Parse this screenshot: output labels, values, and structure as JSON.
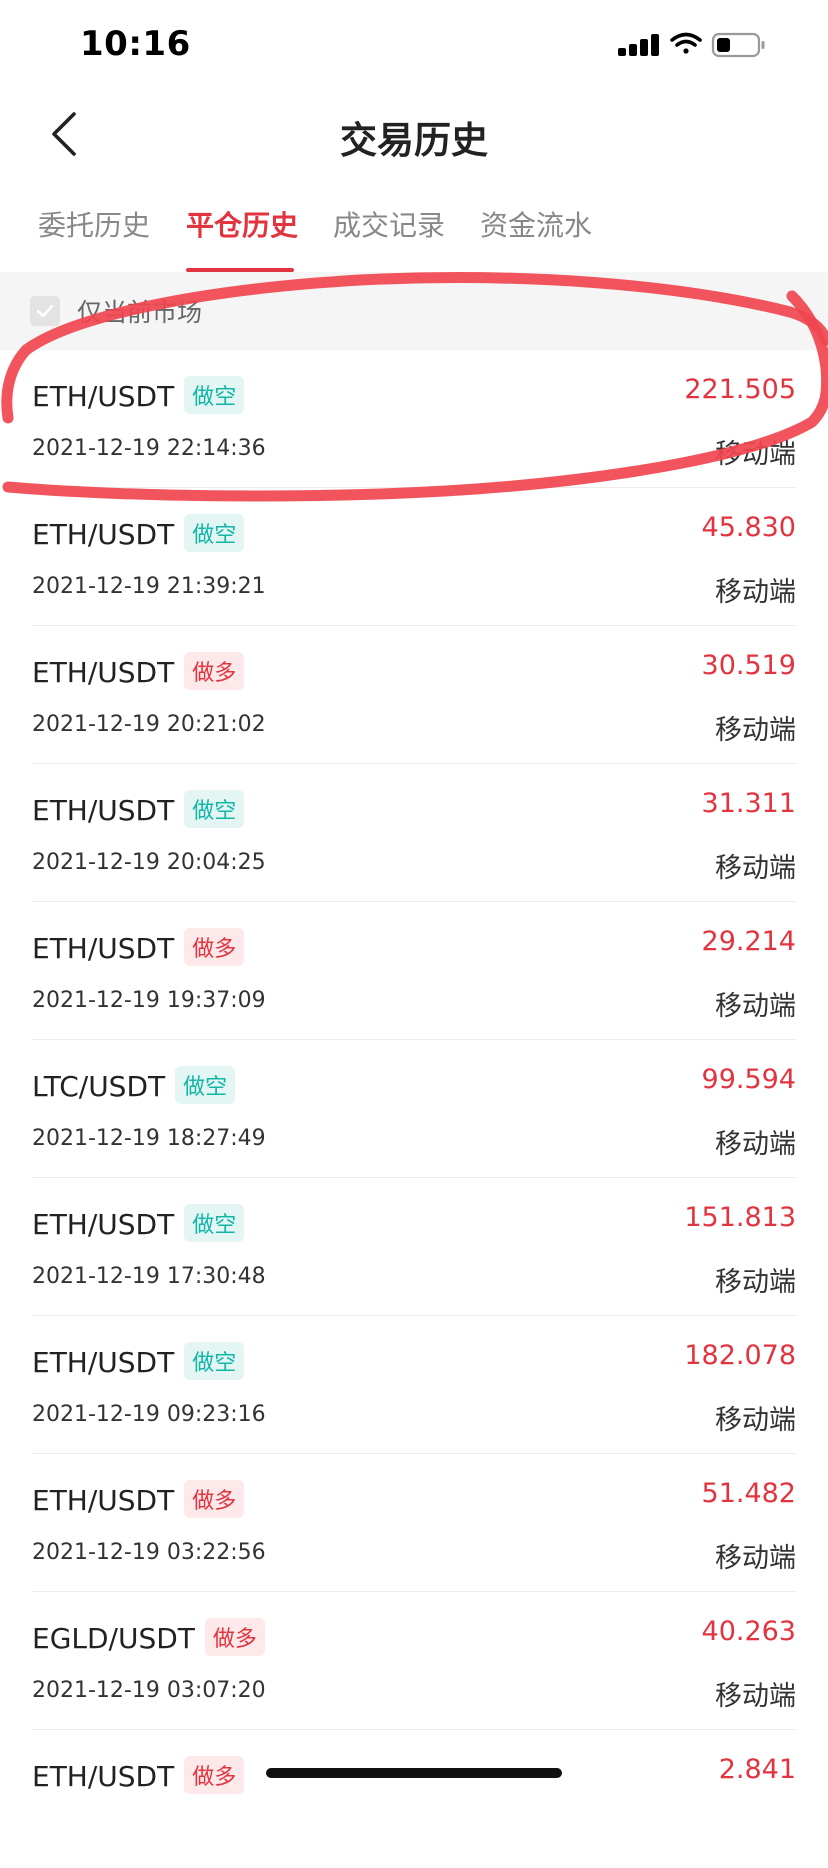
{
  "status_bar": {
    "time": "10:16"
  },
  "nav": {
    "title": "交易历史"
  },
  "tabs": [
    {
      "label": "委托历史",
      "active": false
    },
    {
      "label": "平仓历史",
      "active": true
    },
    {
      "label": "成交记录",
      "active": false
    },
    {
      "label": "资金流水",
      "active": false
    }
  ],
  "filter": {
    "label": "仅当前市场",
    "checked": true
  },
  "trades": [
    {
      "pair": "ETH/USDT",
      "side": "做空",
      "side_type": "short",
      "time": "2021-12-19 22:14:36",
      "amount": "221.505",
      "channel": "移动端"
    },
    {
      "pair": "ETH/USDT",
      "side": "做空",
      "side_type": "short",
      "time": "2021-12-19 21:39:21",
      "amount": "45.830",
      "channel": "移动端"
    },
    {
      "pair": "ETH/USDT",
      "side": "做多",
      "side_type": "long",
      "time": "2021-12-19 20:21:02",
      "amount": "30.519",
      "channel": "移动端"
    },
    {
      "pair": "ETH/USDT",
      "side": "做空",
      "side_type": "short",
      "time": "2021-12-19 20:04:25",
      "amount": "31.311",
      "channel": "移动端"
    },
    {
      "pair": "ETH/USDT",
      "side": "做多",
      "side_type": "long",
      "time": "2021-12-19 19:37:09",
      "amount": "29.214",
      "channel": "移动端"
    },
    {
      "pair": "LTC/USDT",
      "side": "做空",
      "side_type": "short",
      "time": "2021-12-19 18:27:49",
      "amount": "99.594",
      "channel": "移动端"
    },
    {
      "pair": "ETH/USDT",
      "side": "做空",
      "side_type": "short",
      "time": "2021-12-19 17:30:48",
      "amount": "151.813",
      "channel": "移动端"
    },
    {
      "pair": "ETH/USDT",
      "side": "做空",
      "side_type": "short",
      "time": "2021-12-19 09:23:16",
      "amount": "182.078",
      "channel": "移动端"
    },
    {
      "pair": "ETH/USDT",
      "side": "做多",
      "side_type": "long",
      "time": "2021-12-19 03:22:56",
      "amount": "51.482",
      "channel": "移动端"
    },
    {
      "pair": "EGLD/USDT",
      "side": "做多",
      "side_type": "long",
      "time": "2021-12-19 03:07:20",
      "amount": "40.263",
      "channel": "移动端"
    },
    {
      "pair": "ETH/USDT",
      "side": "做多",
      "side_type": "long",
      "time": "",
      "amount": "2.841",
      "channel": ""
    }
  ],
  "colors": {
    "accent": "#e2343f",
    "short": "#13b5a6",
    "long": "#e2343f",
    "annotation": "#f0454f"
  },
  "icons": {
    "back": "chevron-left-icon",
    "check": "check-icon",
    "signal": "cellular-signal-icon",
    "wifi": "wifi-icon",
    "battery": "battery-icon"
  }
}
